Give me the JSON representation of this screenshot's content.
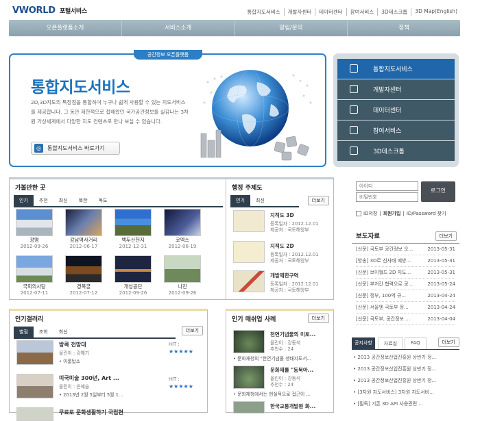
{
  "logo": {
    "brand": "VWORLD",
    "sub": "포털서비스"
  },
  "toplinks": [
    "통합지도서비스",
    "개발자센터",
    "데이터센터",
    "참여서비스",
    "3D데스크톱",
    "3D Map(English)"
  ],
  "gnb": [
    "오픈플랫폼소개",
    "서비스소개",
    "알림/문의",
    "정책"
  ],
  "hero": {
    "tag": "공간정보 오픈플랫폼",
    "title": "통합지도서비스",
    "desc": "2D,3D지도의 특장점을 통합하여 누구나 쉽게 사용할 수 있는 지도서비스를 제공합니다. 그 동안 제한적으로 접해왔던 국가공간정보를 실감나는 3차원 가상세계에서 다양한 지도 컨텐츠로 만나 보실 수 있습니다.",
    "button": "통합지도서비스 바로가기"
  },
  "side": [
    "통합지도서비스",
    "개발자센터",
    "데이터센터",
    "참여서비스",
    "3D데스크톱"
  ],
  "places": {
    "title": "가볼만한 곳",
    "tabs": [
      "인기",
      "추천",
      "최신",
      "북한",
      "독도"
    ],
    "items": [
      {
        "name": "광명",
        "date": "2012-09-26"
      },
      {
        "name": "강남역사거리",
        "date": "2012-06-17"
      },
      {
        "name": "백두산천지",
        "date": "2012-12-31"
      },
      {
        "name": "코엑스",
        "date": "2012-06-19"
      },
      {
        "name": "국회의사당",
        "date": "2012-07-11"
      },
      {
        "name": "경복궁",
        "date": "2012-07-12"
      },
      {
        "name": "개성공단",
        "date": "2012-09-26"
      },
      {
        "name": "나진",
        "date": "2012-09-26"
      }
    ]
  },
  "themes": {
    "title": "행정 주제도",
    "tabs": [
      "인기",
      "최신"
    ],
    "more": "더보기",
    "items": [
      {
        "name": "지적도 3D",
        "reg": "등록일자 : 2012.12.01",
        "org": "제공처 : 국토해양부"
      },
      {
        "name": "지적도 2D",
        "reg": "등록일자 : 2012.12.01",
        "org": "제공처 : 국토해양부"
      },
      {
        "name": "개발제한구역",
        "reg": "등록일자 : 2012.12.01",
        "org": "제공처 : 국토해양부"
      }
    ]
  },
  "login": {
    "id": "아이디",
    "pw": "비밀번호",
    "button": "로그인",
    "save": "ID저장",
    "join": "회원가입",
    "find": "ID/Password 찾기"
  },
  "press": {
    "title": "보도자료",
    "more": "더보기",
    "items": [
      {
        "t": "[신문] 국토부 공간정보 오...",
        "d": "2013-05-31"
      },
      {
        "t": "[방송] 3D로 신사태 예방...",
        "d": "2013-05-31"
      },
      {
        "t": "[신문] 브이월드 2D 지도...",
        "d": "2013-05-31"
      },
      {
        "t": "[신문] 부처간 협력으로 공...",
        "d": "2013-05-24"
      },
      {
        "t": "[신문] 정부, 100억 규...",
        "d": "2013-04-24"
      },
      {
        "t": "[신문] 서울엔 국토부 정...",
        "d": "2013-04-24"
      },
      {
        "t": "[신문] 국토부, 공간정보 ...",
        "d": "2013-04-04"
      }
    ]
  },
  "gallery": {
    "title": "인기갤러리",
    "tabs": [
      "별점",
      "조회",
      "최신"
    ],
    "more": "더보기",
    "items": [
      {
        "title": "방콕 전망대",
        "author": "올린이 : 강해기",
        "tag": "• 이룸탑소",
        "hit": "HIT :"
      },
      {
        "title": "미국미술 300년, Art ...",
        "author": "올린이 : 은혜슬",
        "tag": "• 2013년 2월 5일부터 5월 1...",
        "hit": "HIT :"
      },
      {
        "title": "무료로 문화생활하기 국립현",
        "author": "",
        "tag": "",
        "hit": ""
      }
    ]
  },
  "mashup": {
    "title": "인기 매쉬업 사례",
    "more": "더보기",
    "items": [
      {
        "title": "천연기념물의 미토...",
        "author": "올린이 : 강동석",
        "rec": "추천수 : 24",
        "desc": "• 문화재청의 \"천연기념물 생태지도서..."
      },
      {
        "title": "문화재를 \"동북아...",
        "author": "올린이 : 강동석",
        "rec": "추천수 : 24",
        "desc": "• 문화재청에서는 현실적으로 접근이 ..."
      },
      {
        "title": "한국교통개발원 화...",
        "author": "",
        "rec": "",
        "desc": ""
      }
    ]
  },
  "notice": {
    "tabs": [
      "공지사항",
      "자료실",
      "FAQ"
    ],
    "more": "더보기",
    "items": [
      "• 2013 공간정보산업진흥원 상반기 정...",
      "• 2013 공간정보산업진흥원 상반기 정...",
      "• 2013 공간정보산업진흥원 상반기 정...",
      "• [3차원 지도서비스] 3차원 지도서비...",
      "• [필독] 기존 3D API 사용관련 ..."
    ]
  },
  "colors": {
    "accent": "#2d7fc5",
    "nav": "#3f5966",
    "star": "#2a6fbf"
  }
}
